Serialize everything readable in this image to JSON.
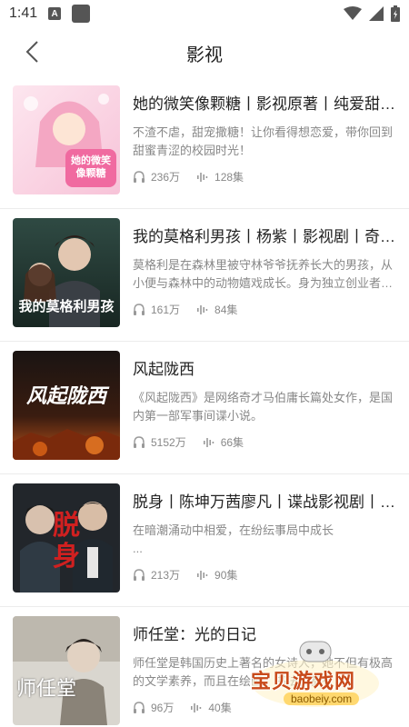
{
  "status_bar": {
    "time": "1:41",
    "a_label": "A"
  },
  "nav": {
    "title": "影视"
  },
  "items": [
    {
      "title": "她的微笑像颗糖丨影视原著丨纯爱甜宠丨多人有声剧",
      "description": "不渣不虐，甜宠撒糖！让你看得想恋爱，带你回到甜蜜青涩的校园时光！",
      "plays": "236万",
      "episodes": "128集",
      "cover_text": "她的微笑像颗糖"
    },
    {
      "title": "我的莫格利男孩丨杨紫丨影视剧丨奇幻爱情",
      "description": "莫格利是在森林里被守林爷爷抚养长大的男孩，从小便与森林中的动物嬉戏成长。身为独立创业者的女主角",
      "plays": "161万",
      "episodes": "84集",
      "cover_text": "我的莫格利男孩"
    },
    {
      "title": "风起陇西",
      "description": "《风起陇西》是网络奇才马伯庸长篇处女作，是国内第一部军事间谍小说。",
      "plays": "5152万",
      "episodes": "66集",
      "cover_text": "风起陇西"
    },
    {
      "title": "脱身丨陈坤万茜廖凡丨谍战影视剧丨有声剧",
      "description": "在暗潮涌动中相爱，在纷纭事局中成长\n...",
      "plays": "213万",
      "episodes": "90集",
      "cover_text": "脱身"
    },
    {
      "title": "师任堂：光的日记",
      "description": "师任堂是韩国历史上著名的女诗人，她不但有极高的文学素养，而且在绘画、书法上都有",
      "plays": "96万",
      "episodes": "40集",
      "cover_text": "师任堂"
    }
  ],
  "watermark": {
    "text": "宝贝游戏网",
    "url": "baobeiy.com"
  },
  "colors": {
    "accent": "#222222",
    "secondary_text": "#888888",
    "divider": "#ececec"
  }
}
